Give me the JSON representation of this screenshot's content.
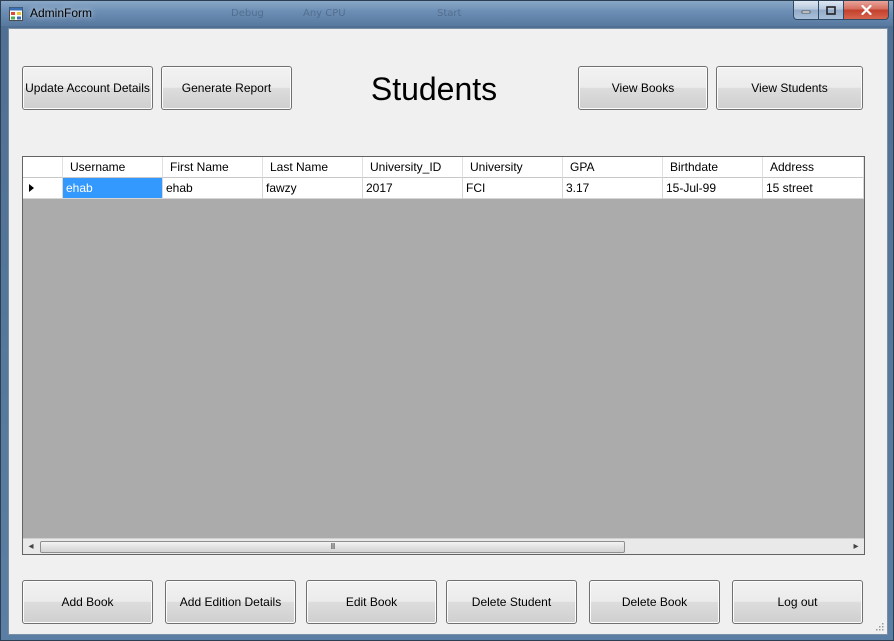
{
  "window": {
    "title": "AdminForm",
    "background_ghost_texts": [
      "Debug",
      "Any CPU",
      "Start"
    ]
  },
  "header": {
    "title": "Students",
    "buttons": {
      "update_account": "Update Account Details",
      "generate_report": "Generate Report",
      "view_books": "View Books",
      "view_students": "View Students"
    }
  },
  "grid": {
    "columns": [
      "Username",
      "First Name",
      "Last Name",
      "University_ID",
      "University",
      "GPA",
      "Birthdate",
      "Address"
    ],
    "rows": [
      {
        "Username": "ehab",
        "First Name": "ehab",
        "Last Name": "fawzy",
        "University_ID": "2017",
        "University": "FCI",
        "GPA": "3.17",
        "Birthdate": "15-Jul-99",
        "Address": "15 street"
      }
    ],
    "selected_cell": {
      "row": 0,
      "column": "Username"
    },
    "scrollbar": {
      "grip_glyph": "III",
      "left_arrow": "◂",
      "right_arrow": "▸"
    }
  },
  "footer": {
    "buttons": {
      "add_book": "Add Book",
      "add_edition": "Add Edition Details",
      "edit_book": "Edit Book",
      "delete_student": "Delete Student",
      "delete_book": "Delete Book",
      "log_out": "Log out"
    }
  },
  "colors": {
    "selection": "#3399ff",
    "grid_background": "#ababab",
    "client_background": "#f0f0f0",
    "close_button": "#c2402c"
  }
}
